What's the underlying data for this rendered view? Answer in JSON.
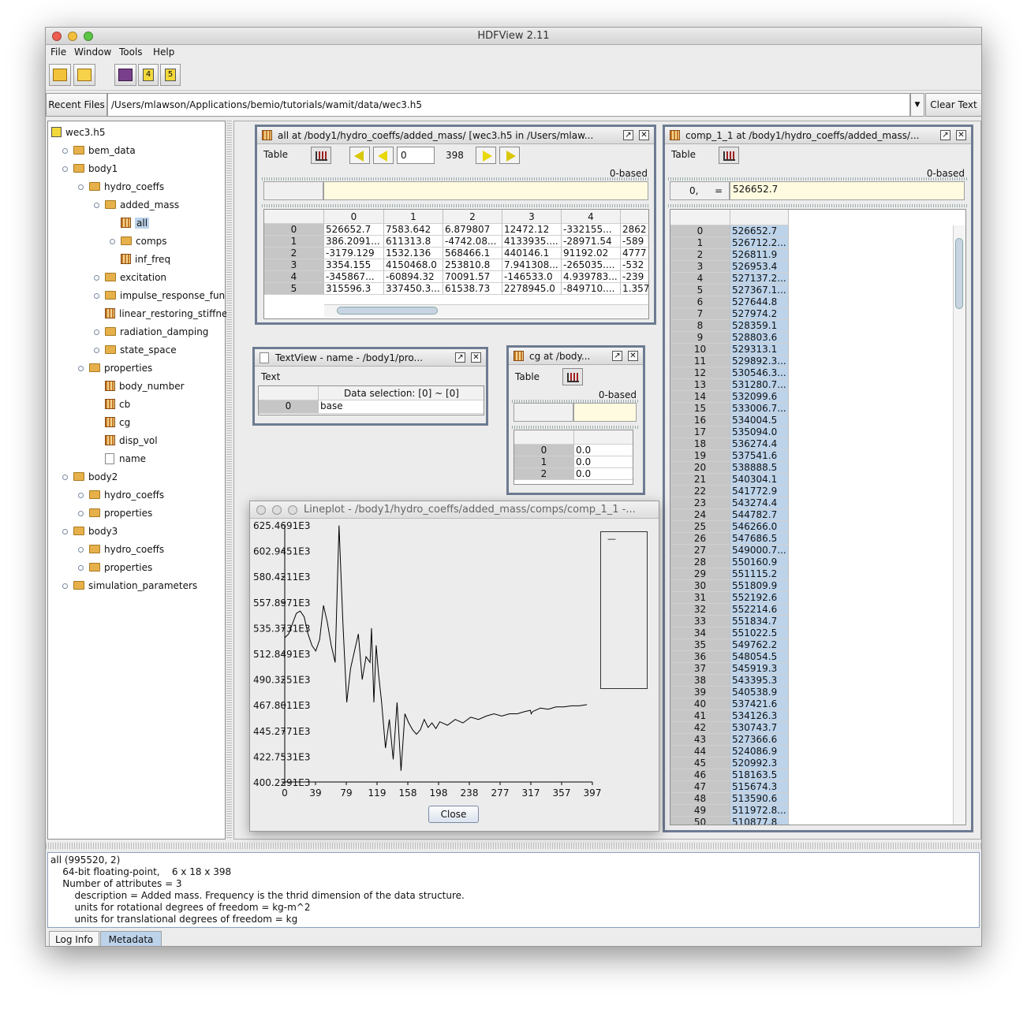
{
  "window": {
    "title": "HDFView 2.11"
  },
  "menu": [
    "File",
    "Window",
    "Tools",
    "Help"
  ],
  "toolbar": {
    "open": "open-folder-icon",
    "open_recent": "open-read-only-icon",
    "help": "help-book-icon",
    "h4": "hdf4-icon",
    "h5": "hdf5-icon"
  },
  "pathbar": {
    "recent_label": "Recent Files",
    "path": "/Users/mlawson/Applications/bemio/tutorials/wamit/data/wec3.h5",
    "clear_label": "Clear Text"
  },
  "tree": [
    {
      "label": "wec3.h5",
      "icon": "h5-file-icon"
    },
    {
      "label": "bem_data",
      "icon": "folder-icon"
    },
    {
      "label": "body1",
      "icon": "folder-open-icon"
    },
    {
      "label": "hydro_coeffs",
      "icon": "folder-open-icon"
    },
    {
      "label": "added_mass",
      "icon": "folder-open-icon"
    },
    {
      "label": "all",
      "icon": "dataset-icon"
    },
    {
      "label": "comps",
      "icon": "folder-icon"
    },
    {
      "label": "inf_freq",
      "icon": "dataset-icon"
    },
    {
      "label": "excitation",
      "icon": "folder-icon"
    },
    {
      "label": "impulse_response_fun",
      "icon": "folder-icon"
    },
    {
      "label": "linear_restoring_stiffness",
      "icon": "dataset-icon"
    },
    {
      "label": "radiation_damping",
      "icon": "folder-icon"
    },
    {
      "label": "state_space",
      "icon": "folder-icon"
    },
    {
      "label": "properties",
      "icon": "folder-open-icon"
    },
    {
      "label": "body_number",
      "icon": "dataset-icon"
    },
    {
      "label": "cb",
      "icon": "dataset-icon"
    },
    {
      "label": "cg",
      "icon": "dataset-icon"
    },
    {
      "label": "disp_vol",
      "icon": "dataset-icon"
    },
    {
      "label": "name",
      "icon": "text-dataset-icon"
    },
    {
      "label": "body2",
      "icon": "folder-open-icon"
    },
    {
      "label": "hydro_coeffs",
      "icon": "folder-icon"
    },
    {
      "label": "properties",
      "icon": "folder-icon"
    },
    {
      "label": "body3",
      "icon": "folder-open-icon"
    },
    {
      "label": "hydro_coeffs",
      "icon": "folder-icon"
    },
    {
      "label": "properties",
      "icon": "folder-icon"
    },
    {
      "label": "simulation_parameters",
      "icon": "folder-icon"
    }
  ],
  "all_view": {
    "title": "all  at  /body1/hydro_coeffs/added_mass/  [wec3.h5  in  /Users/mlaw...",
    "table_label": "Table",
    "page_value": "0",
    "page_max": "398",
    "based": "0-based",
    "columns": [
      "0",
      "1",
      "2",
      "3",
      "4",
      ""
    ],
    "rows": [
      {
        "idx": "0",
        "cells": [
          "526652.7",
          "7583.642",
          "6.879807",
          "12472.12",
          "-332155...",
          "2862"
        ]
      },
      {
        "idx": "1",
        "cells": [
          "386.2091...",
          "611313.8",
          "-4742.08...",
          "4133935....",
          "-28971.54",
          "-589"
        ]
      },
      {
        "idx": "2",
        "cells": [
          "-3179.129",
          "1532.136",
          "568466.1",
          "440146.1",
          "91192.02",
          "4777"
        ]
      },
      {
        "idx": "3",
        "cells": [
          "3354.155",
          "4150468.0",
          "253810.8",
          "7.941308...",
          "-265035....",
          "-532"
        ]
      },
      {
        "idx": "4",
        "cells": [
          "-345867...",
          "-60894.32",
          "70091.57",
          "-146533.0",
          "4.939783...",
          "-239"
        ]
      },
      {
        "idx": "5",
        "cells": [
          "315596.3",
          "337450.3...",
          "61538.73",
          "2278945.0",
          "-849710....",
          "1.357"
        ]
      }
    ]
  },
  "textview": {
    "title": "TextView  -  name  -  /body1/pro...",
    "text_label": "Text",
    "selection": "Data selection:   [0] ~ [0]",
    "row_idx": "0",
    "row_value": "base"
  },
  "cg_view": {
    "title": "cg  at  /body...",
    "table_label": "Table",
    "based": "0-based",
    "rows": [
      {
        "idx": "0",
        "value": "0.0"
      },
      {
        "idx": "1",
        "value": "0.0"
      },
      {
        "idx": "2",
        "value": "0.0"
      }
    ]
  },
  "comp_view": {
    "title": "comp_1_1  at  /body1/hydro_coeffs/added_mass/...",
    "table_label": "Table",
    "based": "0-based",
    "cell_ref": "0,",
    "equals": "=",
    "cell_value": "526652.7",
    "rows": [
      "526652.7",
      "526712.2...",
      "526811.9",
      "526953.4",
      "527137.2...",
      "527367.1...",
      "527644.8",
      "527974.2",
      "528359.1",
      "528803.6",
      "529313.1",
      "529892.3...",
      "530546.3...",
      "531280.7...",
      "532099.6",
      "533006.7...",
      "534004.5",
      "535094.0",
      "536274.4",
      "537541.6",
      "538888.5",
      "540304.1",
      "541772.9",
      "543274.4",
      "544782.7",
      "546266.0",
      "547686.5",
      "549000.7...",
      "550160.9",
      "551115.2",
      "551809.9",
      "552192.6",
      "552214.6",
      "551834.7",
      "551022.5",
      "549762.2",
      "548054.5",
      "545919.3",
      "543395.3",
      "540538.9",
      "537421.6",
      "534126.3",
      "530743.7",
      "527366.6",
      "524086.9",
      "520992.3",
      "518163.5",
      "515674.3",
      "513590.6",
      "511972.8...",
      "510877.8"
    ]
  },
  "lineplot": {
    "title": "Lineplot - /body1/hydro_coeffs/added_mass/comps/comp_1_1 -...",
    "close_label": "Close",
    "legend_text": "—"
  },
  "chart_data": {
    "type": "line",
    "yticks": [
      "625.4691E3",
      "602.9451E3",
      "580.4211E3",
      "557.8971E3",
      "535.3731E3",
      "512.8491E3",
      "490.3251E3",
      "467.8011E3",
      "445.2771E3",
      "422.7531E3",
      "400.2291E3"
    ],
    "xticks": [
      "0",
      "39",
      "79",
      "119",
      "158",
      "198",
      "238",
      "277",
      "317",
      "357",
      "397"
    ],
    "xlim": [
      0,
      397
    ],
    "ylim": [
      400229.1,
      625469.1
    ],
    "x": [
      0,
      5,
      10,
      15,
      20,
      25,
      30,
      35,
      40,
      45,
      50,
      55,
      60,
      65,
      70,
      75,
      80,
      85,
      90,
      95,
      100,
      105,
      110,
      112,
      115,
      118,
      121,
      125,
      130,
      135,
      140,
      145,
      150,
      155,
      160,
      165,
      170,
      175,
      180,
      185,
      190,
      195,
      200,
      210,
      220,
      230,
      240,
      250,
      260,
      270,
      280,
      290,
      300,
      310,
      317,
      318,
      320,
      330,
      340,
      350,
      360,
      370,
      380,
      390
    ],
    "y": [
      526652,
      530000,
      539000,
      548000,
      550000,
      545000,
      530000,
      520000,
      515000,
      525000,
      555000,
      540000,
      520000,
      505000,
      625000,
      540000,
      470000,
      500000,
      515000,
      530000,
      490000,
      510000,
      505000,
      535000,
      470000,
      520000,
      495000,
      470000,
      430000,
      455000,
      420000,
      470000,
      410000,
      460000,
      452000,
      446000,
      442000,
      446000,
      455000,
      448000,
      452000,
      447000,
      453000,
      450000,
      455000,
      452000,
      457000,
      455000,
      458000,
      460000,
      458000,
      460000,
      460000,
      462000,
      463000,
      460000,
      462000,
      465000,
      464000,
      466000,
      466000,
      467000,
      467000,
      468000
    ]
  },
  "metadata": {
    "lines": [
      "all (995520, 2)",
      "    64-bit floating-point,    6 x 18 x 398",
      "    Number of attributes = 3",
      "        description = Added mass. Frequency is the thrid dimension of the data structure.",
      "        units for rotational degrees of freedom = kg-m^2",
      "        units for translational degrees of freedom = kg"
    ]
  },
  "tabs": [
    "Log Info",
    "Metadata"
  ]
}
